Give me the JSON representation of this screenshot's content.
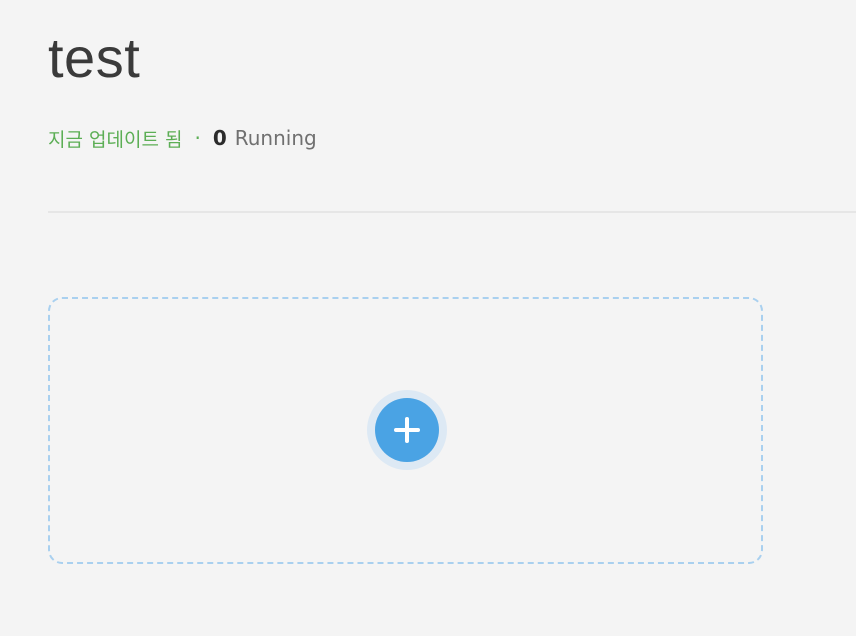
{
  "header": {
    "title": "test"
  },
  "status": {
    "updated_text": "지금 업데이트 됨",
    "separator": "·",
    "running_count": "0",
    "running_label": "Running"
  },
  "add_card": {
    "icon": "plus-icon",
    "accent_color": "#4aa3e4",
    "border_color": "#a9d0ef"
  },
  "colors": {
    "background": "#f4f4f4",
    "updated_text": "#5cae55",
    "title_text": "#3a3a3a"
  }
}
